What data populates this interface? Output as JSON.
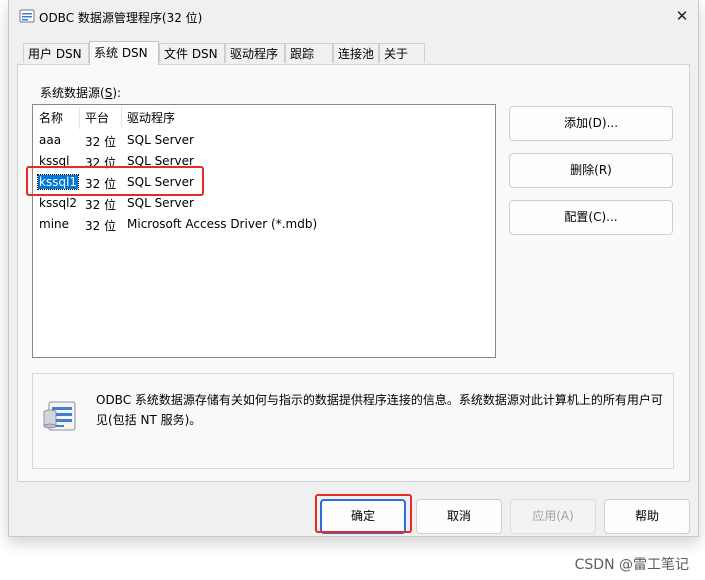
{
  "window": {
    "title": "ODBC 数据源管理程序(32 位)",
    "close_glyph": "✕"
  },
  "tabs": [
    {
      "label": "用户 DSN",
      "active": false
    },
    {
      "label": "系统 DSN",
      "active": true
    },
    {
      "label": "文件 DSN",
      "active": false
    },
    {
      "label": "驱动程序",
      "active": false
    },
    {
      "label": "跟踪",
      "active": false
    },
    {
      "label": "连接池",
      "active": false
    },
    {
      "label": "关于",
      "active": false
    }
  ],
  "datasource_list": {
    "label_text": "系统数据源(",
    "label_key": "S",
    "label_end": "):",
    "columns": [
      "名称",
      "平台",
      "驱动程序"
    ],
    "rows": [
      {
        "name": "aaa",
        "platform": "32 位",
        "driver": "SQL Server",
        "selected": false
      },
      {
        "name": "kssql",
        "platform": "32 位",
        "driver": "SQL Server",
        "selected": false
      },
      {
        "name": "kssql1",
        "platform": "32 位",
        "driver": "SQL Server",
        "selected": true
      },
      {
        "name": "kssql2",
        "platform": "32 位",
        "driver": "SQL Server",
        "selected": false
      },
      {
        "name": "mine",
        "platform": "32 位",
        "driver": "Microsoft Access Driver (*.mdb)",
        "selected": false
      }
    ]
  },
  "side_buttons": {
    "add": "添加(D)...",
    "remove": "删除(R)",
    "configure": "配置(C)..."
  },
  "info": {
    "icon": "database-icon",
    "text": "ODBC 系统数据源存储有关如何与指示的数据提供程序连接的信息。系统数据源对此计算机上的所有用户可见(包括 NT 服务)。"
  },
  "footer_buttons": {
    "ok": "确定",
    "cancel": "取消",
    "apply": "应用(A)",
    "help": "帮助"
  },
  "watermark": "CSDN @雷工笔记",
  "colors": {
    "selection": "#0078d7",
    "annotation_red": "#e42b26",
    "default_button_border": "#2f6ed8"
  }
}
